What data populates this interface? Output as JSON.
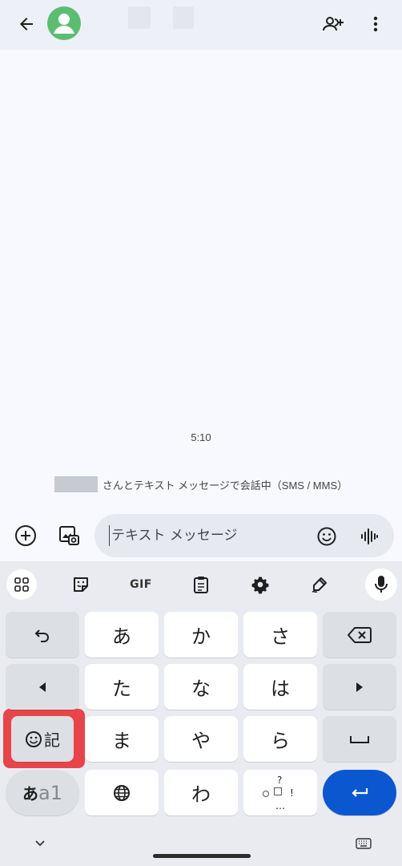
{
  "header": {
    "back_icon": "arrow-left-icon",
    "avatar_icon": "person-icon",
    "add_person_icon": "person-add-icon",
    "more_icon": "more-vert-icon"
  },
  "conversation": {
    "timestamp": "5:10",
    "sms_notice": "さんとテキスト メッセージで会話中（SMS / MMS）"
  },
  "compose": {
    "placeholder": "テキスト メッセージ",
    "value": "",
    "plus_icon": "add-circle-icon",
    "media_icon": "gallery-icon",
    "emoji_icon": "emoji-icon",
    "voice_icon": "voice-waveform-icon"
  },
  "keyboard": {
    "toolbar": {
      "grid_icon": "apps-grid-icon",
      "sticker_icon": "sticker-icon",
      "gif_label": "GIF",
      "clipboard_icon": "clipboard-icon",
      "settings_icon": "gear-icon",
      "handwriting_icon": "handwriting-icon",
      "mic_icon": "mic-icon"
    },
    "keys": {
      "undo_icon": "undo-icon",
      "a": "あ",
      "ka": "か",
      "sa": "さ",
      "backspace_icon": "backspace-icon",
      "left_icon": "arrow-left-solid-icon",
      "ta": "た",
      "na": "な",
      "ha": "は",
      "right_icon": "arrow-right-solid-icon",
      "symbol_label": "記",
      "ma": "ま",
      "ya": "や",
      "ra": "ら",
      "space_icon": "space-icon",
      "mode_kana": "あ",
      "mode_alpha": "a1",
      "globe_icon": "globe-icon",
      "wa": "わ",
      "punct_q": "?",
      "punct_ex": "!",
      "punct_dots": "…",
      "enter_icon": "enter-icon"
    },
    "bottom": {
      "collapse_icon": "chevron-down-icon",
      "keyboard_icon": "keyboard-icon"
    }
  },
  "colors": {
    "accent": "#0b57d0",
    "avatar": "#5bbd72",
    "highlight": "#e8454a"
  }
}
